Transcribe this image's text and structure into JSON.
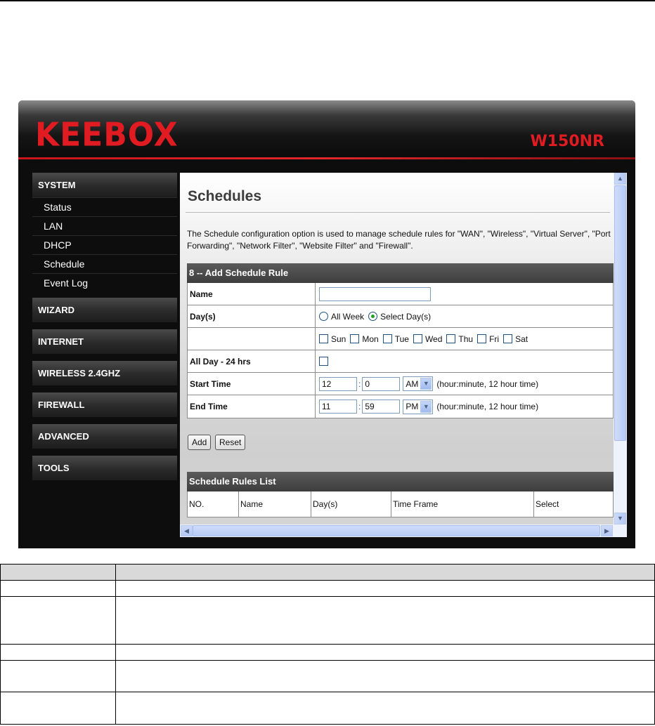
{
  "app": {
    "brand": "KEEBOX",
    "model": "W150NR"
  },
  "sidebar": {
    "system": "SYSTEM",
    "system_items": [
      {
        "label": "Status"
      },
      {
        "label": "LAN"
      },
      {
        "label": "DHCP"
      },
      {
        "label": "Schedule"
      },
      {
        "label": "Event Log"
      }
    ],
    "sections": [
      "WIZARD",
      "INTERNET",
      "WIRELESS 2.4GHZ",
      "FIREWALL",
      "ADVANCED",
      "TOOLS"
    ]
  },
  "page": {
    "title": "Schedules",
    "description": "The Schedule configuration option is used to manage schedule rules for \"WAN\", \"Wireless\", \"Virtual Server\", \"Port Forwarding\", \"Network Filter\", \"Website Filter\" and \"Firewall\"."
  },
  "form": {
    "header": "8 -- Add Schedule Rule",
    "name_label": "Name",
    "name_value": "",
    "days_label": "Day(s)",
    "all_week": "All Week",
    "select_days": "Select Day(s)",
    "days": [
      "Sun",
      "Mon",
      "Tue",
      "Wed",
      "Thu",
      "Fri",
      "Sat"
    ],
    "all_day_label": "All Day - 24 hrs",
    "start_label": "Start Time",
    "start_hour": "12",
    "start_minute": "0",
    "start_ampm": "AM",
    "end_label": "End Time",
    "end_hour": "11",
    "end_minute": "59",
    "end_ampm": "PM",
    "time_sep": ":",
    "time_hint": "(hour:minute, 12 hour time)",
    "add": "Add",
    "reset": "Reset"
  },
  "list": {
    "header": "Schedule Rules List",
    "columns": [
      "NO.",
      "Name",
      "Day(s)",
      "Time Frame",
      "Select"
    ]
  },
  "icons": {
    "scroll_up": "▲",
    "scroll_down": "▼",
    "scroll_left": "◀",
    "scroll_right": "▶",
    "dropdown": "▼"
  }
}
